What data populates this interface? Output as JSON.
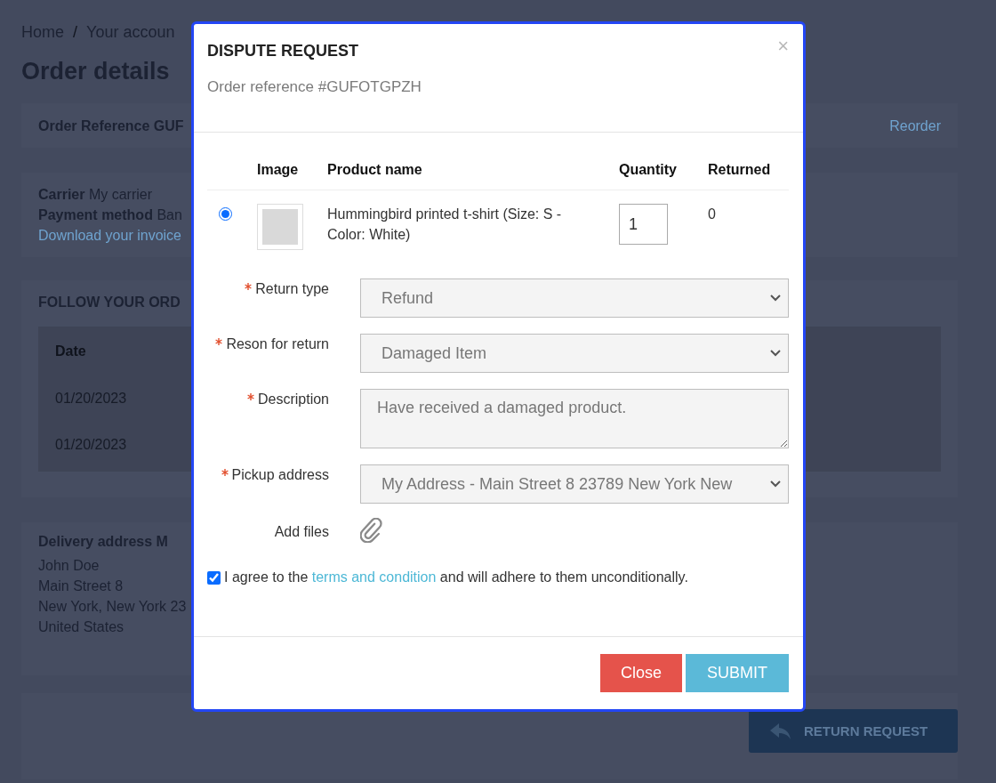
{
  "breadcrumb": [
    {
      "label": "Home",
      "separator": "/"
    },
    {
      "label": "Your accoun"
    }
  ],
  "page_title": "Order details",
  "order_card": {
    "reference": "Order Reference GUF",
    "reorder": "Reorder"
  },
  "info_card": {
    "carrier_label": "Carrier",
    "carrier": "My carrier",
    "payment_label": "Payment method",
    "payment": "Ban",
    "invoice_link": "Download your invoice"
  },
  "follow_card": {
    "title": "FOLLOW YOUR ORD",
    "columns": [
      "Date"
    ],
    "rows": [
      "01/20/2023",
      "01/20/2023"
    ]
  },
  "delivery_card": {
    "title": "Delivery address M",
    "lines": [
      "John Doe",
      "Main Street 8",
      "New York, New York 23",
      "United States"
    ]
  },
  "return_button": "RETURN REQUEST",
  "modal": {
    "title": "DISPUTE REQUEST",
    "close": "×",
    "subtitle": "Order reference #GUFOTGPZH",
    "columns": [
      "Image",
      "Product name",
      "Quantity",
      "Returned"
    ],
    "products": [
      {
        "selected": true,
        "name": "Hummingbird printed t-shirt (Size: S - Color: White)",
        "quantity": "1",
        "returned": "0"
      }
    ],
    "fields": [
      {
        "kind": "select",
        "label": "Return type",
        "required": true,
        "value": "Refund"
      },
      {
        "kind": "select",
        "label": "Reson for return",
        "required": true,
        "value": "Damaged Item"
      },
      {
        "kind": "textarea",
        "label": "Description",
        "required": true,
        "value": "Have received a damaged product."
      },
      {
        "kind": "select",
        "label": "Pickup address",
        "required": true,
        "value": "My Address - Main Street 8 23789 New York New"
      },
      {
        "kind": "file",
        "label": "Add files",
        "required": false
      }
    ],
    "agreement": {
      "checked": true,
      "before": "I agree to the",
      "link": "terms and condition",
      "after": "and will adhere to them unconditionally."
    },
    "buttons": [
      {
        "kind": "close",
        "label": "Close"
      },
      {
        "kind": "submit",
        "label": "SUBMIT"
      }
    ]
  }
}
